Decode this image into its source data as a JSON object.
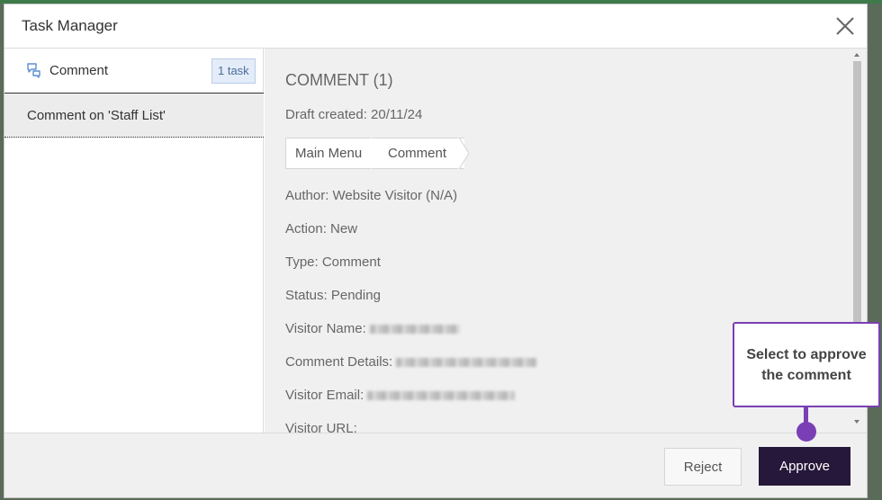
{
  "modal": {
    "title": "Task Manager",
    "close_icon": "close-icon"
  },
  "sidebar": {
    "category": {
      "icon": "speech-bubbles-icon",
      "label": "Comment",
      "badge": "1 task"
    },
    "items": [
      {
        "label": "Comment on 'Staff List'"
      }
    ]
  },
  "detail": {
    "title": "COMMENT (1)",
    "draft_created": "Draft created: 20/11/24",
    "breadcrumb": [
      "Main Menu",
      "Comment"
    ],
    "fields": {
      "author": "Author: Website Visitor (N/A)",
      "action": "Action: New",
      "type": "Type: Comment",
      "status": "Status: Pending",
      "visitor_name": "Visitor Name:",
      "comment_details": "Comment Details:",
      "visitor_email": "Visitor Email:",
      "visitor_url": "Visitor URL:"
    }
  },
  "footer": {
    "reject_label": "Reject",
    "approve_label": "Approve"
  },
  "tooltip": {
    "text": "Select to approve the comment"
  },
  "colors": {
    "accent_purple": "#7a3fb5",
    "approve_bg": "#26183a"
  }
}
